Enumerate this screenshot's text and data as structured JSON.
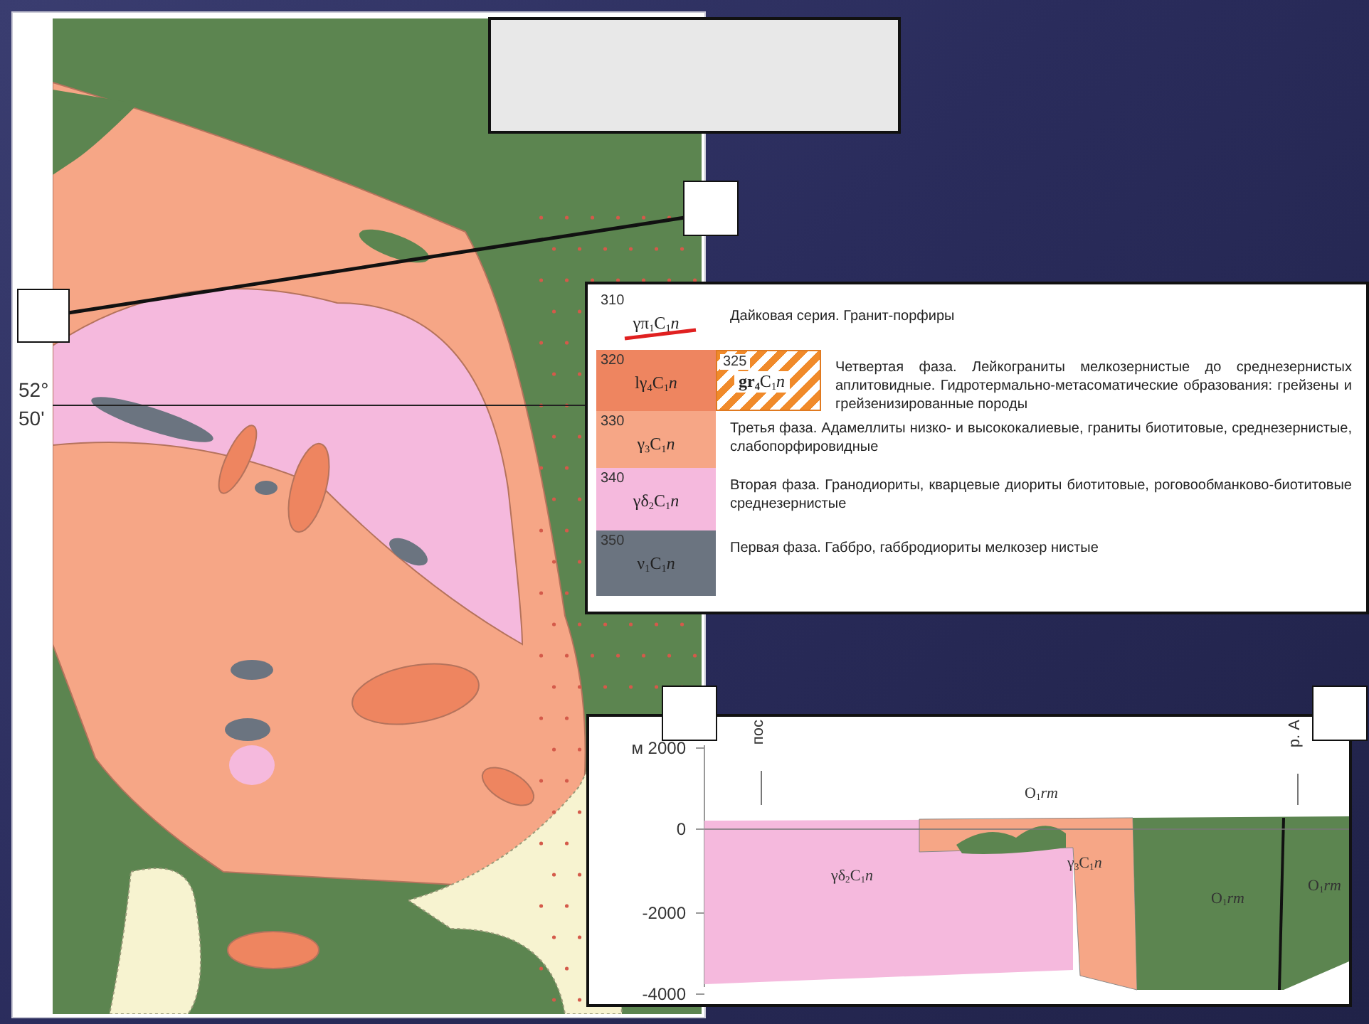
{
  "map": {
    "latitude_labels": [
      "52°",
      "50'"
    ]
  },
  "legend": {
    "items": [
      {
        "kind": "line",
        "code": "310",
        "formula": "γπ$_{1}$C$_{1}$*n*",
        "color": "#ffffff",
        "description": "Дайковая серия. Гранит-порфиры"
      },
      {
        "kind": "area",
        "code": "320",
        "formula": "lγ$_{4}$C$_{1}$*n*",
        "color": "#ee8560",
        "extra": {
          "code": "325",
          "formula": "**gr$_{4}$**C$_{1}$*n*"
        },
        "description": "Четвертая фаза. Лейкограниты мелкозернистые до среднезернистых аплитовидные. Гидротермально-метасоматические образования: грейзены и грейзенизированные породы"
      },
      {
        "kind": "area",
        "code": "330",
        "formula": "γ$_{3}$C$_{1}$*n*",
        "color": "#f6a686",
        "description": "Третья фаза. Адамеллиты низко- и высококалиевые, граниты биотитовые, среднезернистые, слабопорфировидные"
      },
      {
        "kind": "area",
        "code": "340",
        "formula": "γδ$_{2}$C$_{1}$*n*",
        "color": "#f5b9dd",
        "description": "Вторая фаза. Гранодиориты, кварцевые диориты биотитовые, роговообманково-биотитовые среднезернистые"
      },
      {
        "kind": "area",
        "code": "350",
        "formula": "ν$_{1}$C$_{1}$*n*",
        "color": "#6b7480",
        "description": "Первая фаза. Габбро, габбродиориты мелкозер нистые"
      }
    ]
  },
  "section": {
    "y_ticks": [
      "м 2000",
      "0",
      "-2000",
      "-4000"
    ],
    "tops": [
      "пос",
      "р. А"
    ],
    "units": [
      {
        "kind": "rock",
        "label": "O$_{1}$*rm*"
      },
      {
        "kind": "rock",
        "label": "γδ$_{2}$C$_{1}$*n*"
      },
      {
        "kind": "rock",
        "label": "γ$_{3}$C$_{1}$*n*"
      },
      {
        "kind": "rock",
        "label": "O$_{1}$*rm*"
      },
      {
        "kind": "rock",
        "label": "O$_{1}$*rm*"
      }
    ]
  }
}
